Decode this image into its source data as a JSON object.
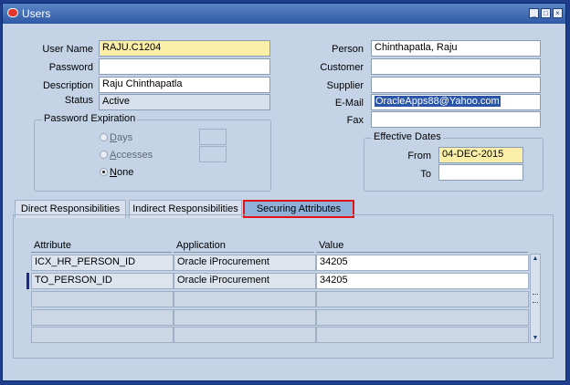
{
  "window": {
    "title": "Users"
  },
  "user": {
    "user_name_label": "User Name",
    "user_name": "RAJU.C1204",
    "password_label": "Password",
    "password": "",
    "description_label": "Description",
    "description": "Raju Chinthapatla",
    "status_label": "Status",
    "status": "Active"
  },
  "contact": {
    "person_label": "Person",
    "person": "Chinthapatla, Raju",
    "customer_label": "Customer",
    "customer": "",
    "supplier_label": "Supplier",
    "supplier": "",
    "email_label": "E-Mail",
    "email": "OracleApps88@Yahoo.com",
    "fax_label": "Fax",
    "fax": ""
  },
  "password_expiration": {
    "title": "Password Expiration",
    "options": [
      "Days",
      "Accesses",
      "None"
    ],
    "selected": "None"
  },
  "effective_dates": {
    "title": "Effective Dates",
    "from_label": "From",
    "from": "04-DEC-2015",
    "to_label": "To",
    "to": ""
  },
  "tabs": [
    "Direct Responsibilities",
    "Indirect Responsibilities",
    "Securing Attributes"
  ],
  "active_tab": "Securing Attributes",
  "attributes_table": {
    "columns": [
      "Attribute",
      "Application",
      "Value"
    ],
    "rows": [
      [
        "ICX_HR_PERSON_ID",
        "Oracle iProcurement",
        "34205"
      ],
      [
        "TO_PERSON_ID",
        "Oracle iProcurement",
        "34205"
      ],
      [
        "",
        "",
        ""
      ],
      [
        "",
        "",
        ""
      ],
      [
        "",
        "",
        ""
      ]
    ]
  },
  "colors": {
    "title_bar": "#2f5aa6",
    "form_bg": "#c5d3e6",
    "required_field": "#fbefa8",
    "tab_highlight": "#e0141b"
  }
}
